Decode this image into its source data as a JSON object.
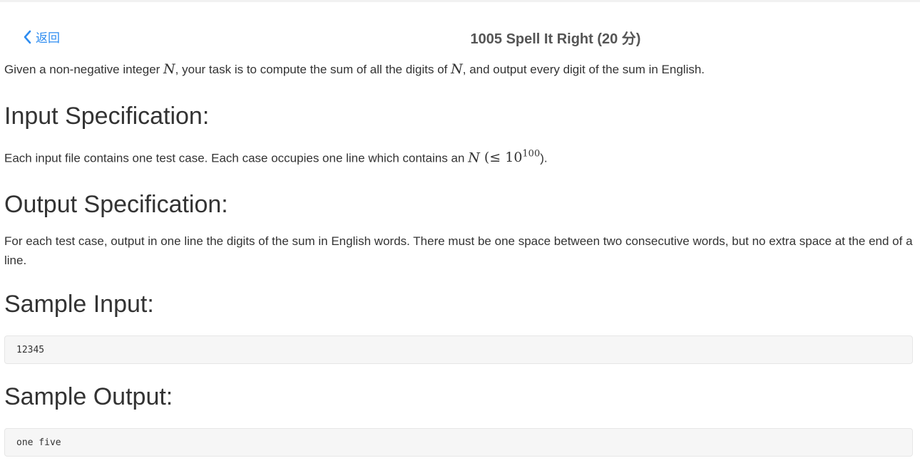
{
  "header": {
    "back_label": "返回",
    "title": "1005 Spell It Right (20 分)"
  },
  "intro": {
    "text_1": "Given a non-negative integer ",
    "var_n": "N",
    "text_2": ", your task is to compute the sum of all the digits of ",
    "var_n2": "N",
    "text_3": ", and output every digit of the sum in English."
  },
  "input_spec": {
    "heading": "Input Specification:",
    "text_1": "Each input file contains one test case. Each case occupies one line which contains an ",
    "var_n": "N",
    "math_open": " (≤ 10",
    "math_exp": "100",
    "math_close": ").",
    "text_end": ""
  },
  "output_spec": {
    "heading": "Output Specification:",
    "text": "For each test case, output in one line the digits of the sum in English words. There must be one space between two consecutive words, but no extra space at the end of a line."
  },
  "sample_input": {
    "heading": "Sample Input:",
    "code": "12345"
  },
  "sample_output": {
    "heading": "Sample Output:",
    "code": "one five"
  },
  "colors": {
    "link": "#2d8cf0",
    "code_bg": "#f6f6f6"
  }
}
